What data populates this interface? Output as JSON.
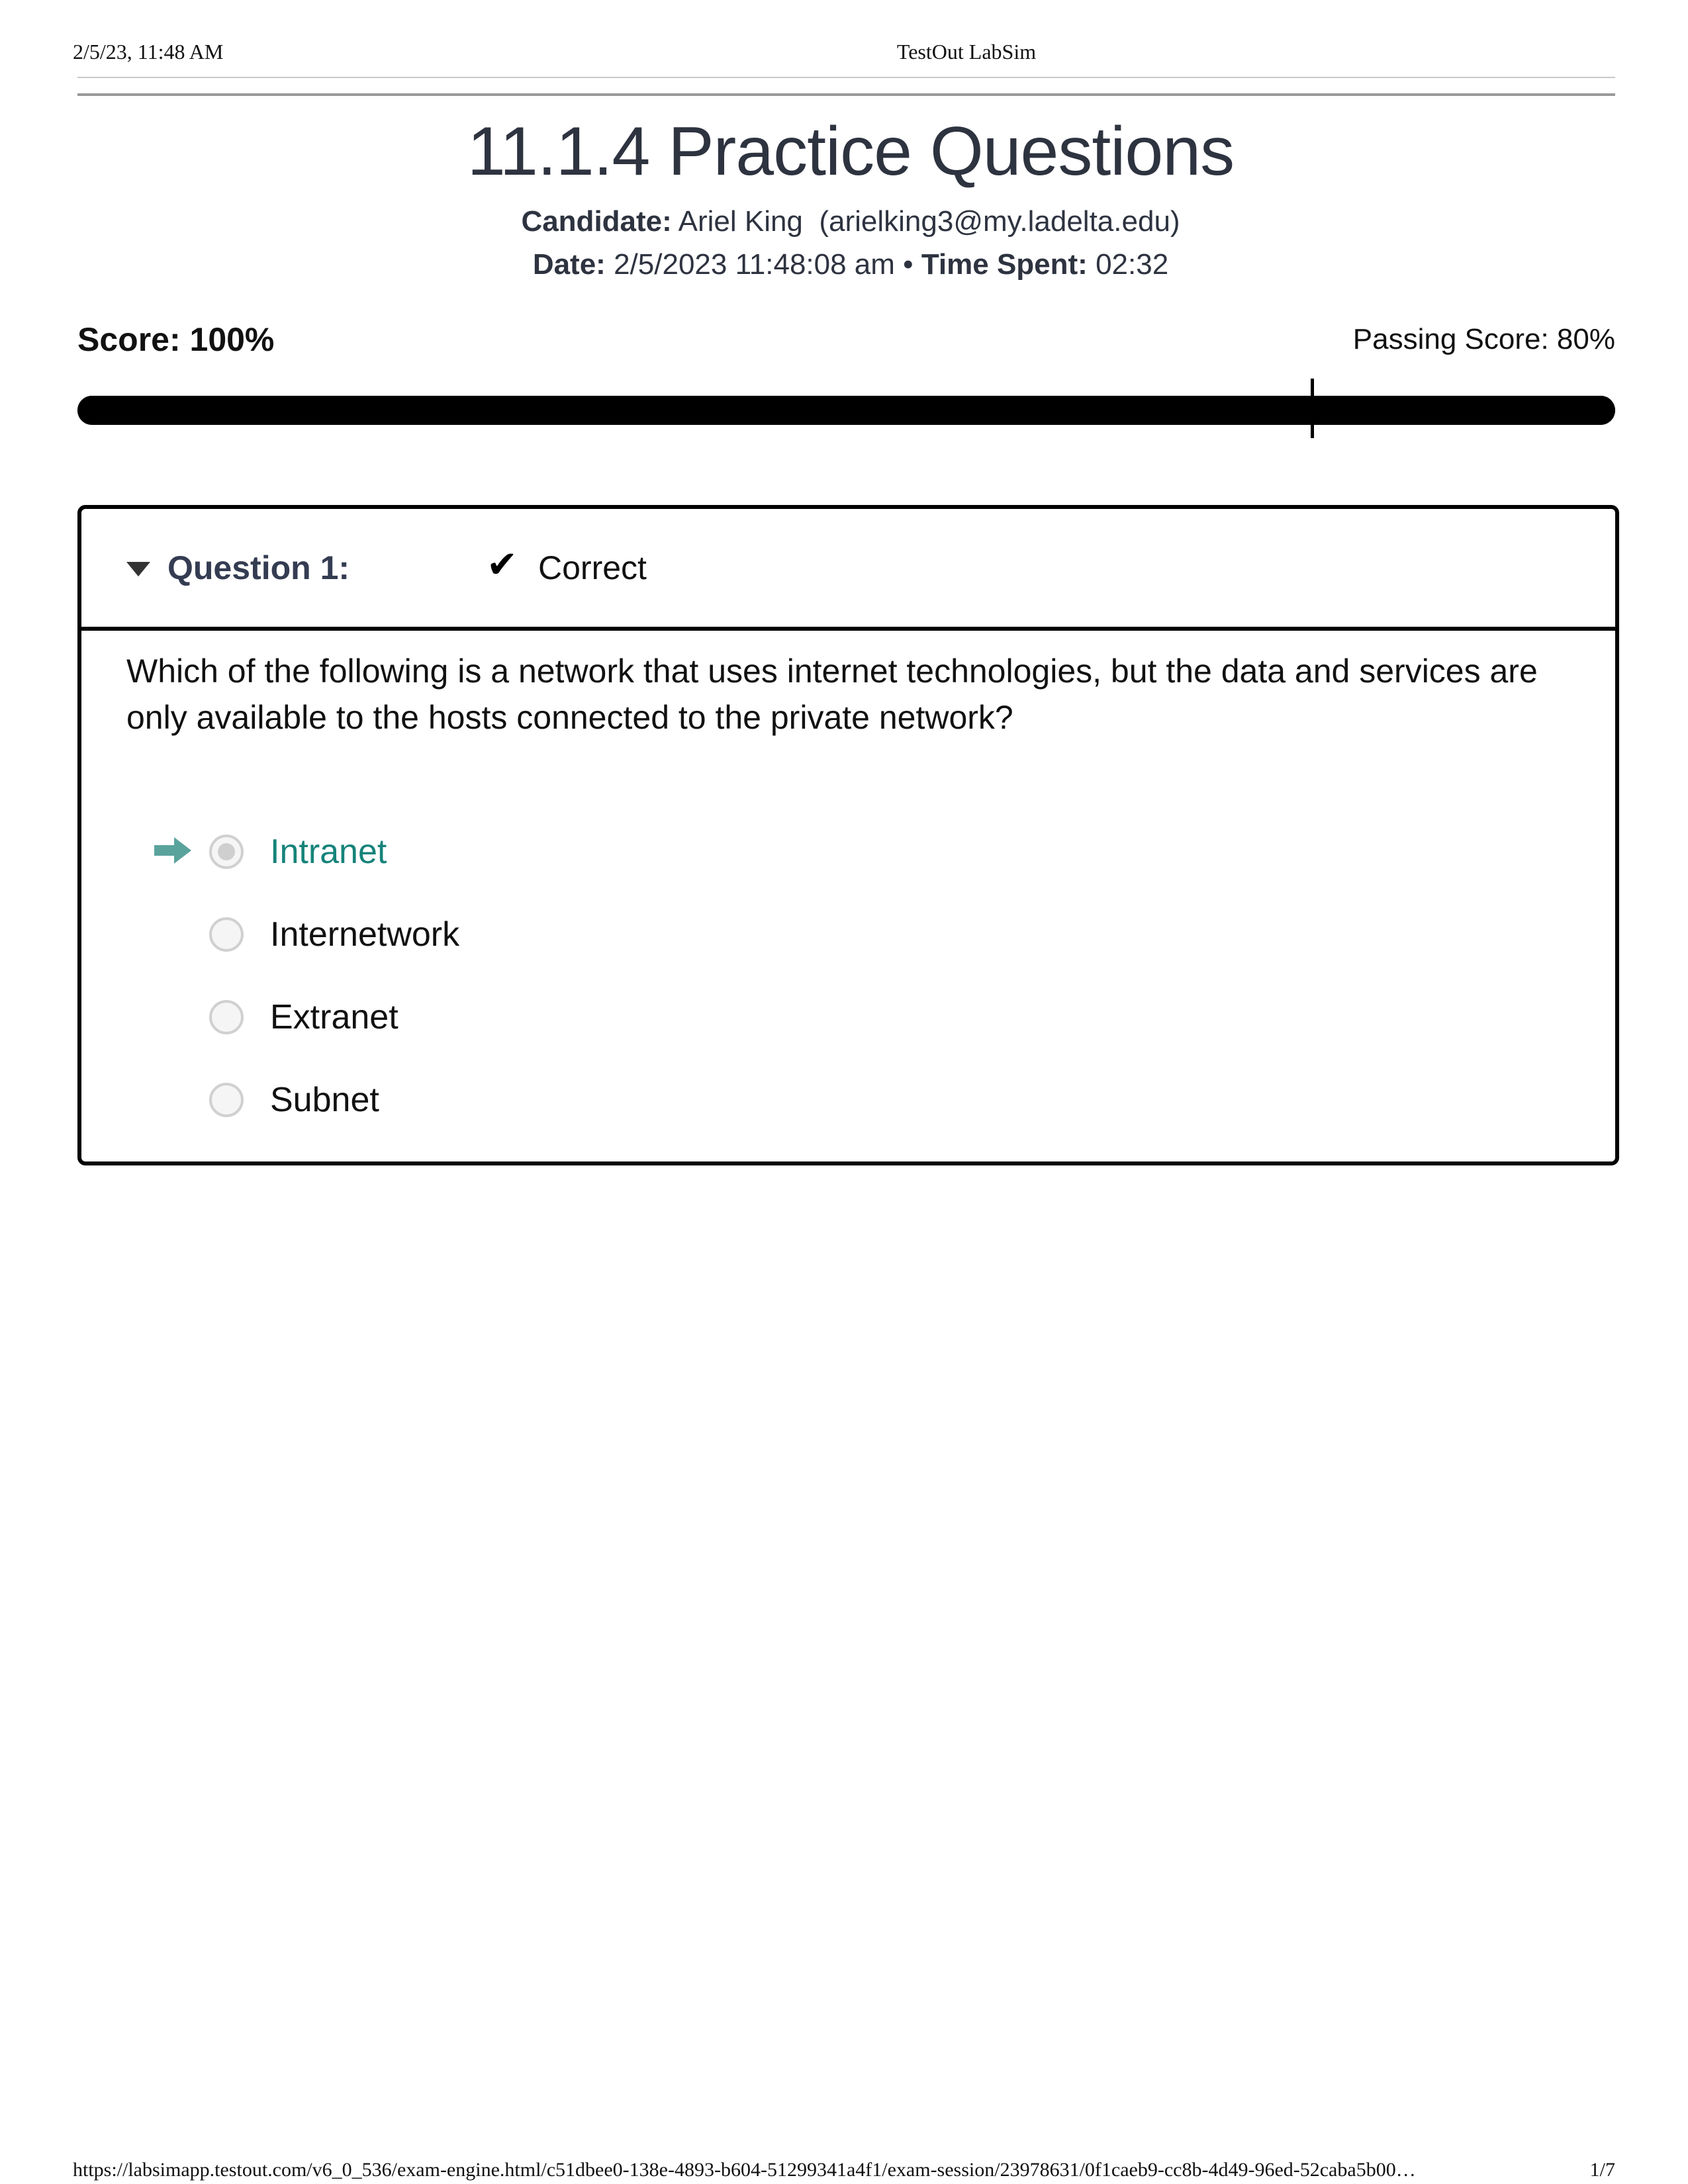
{
  "print_header": {
    "datetime": "2/5/23, 11:48 AM",
    "title": "TestOut LabSim"
  },
  "page": {
    "title": "11.1.4 Practice Questions",
    "candidate_label": "Candidate:",
    "candidate_value": "Ariel King  (arielking3@my.ladelta.edu)",
    "date_label": "Date:",
    "date_value": "2/5/2023 11:48:08 am",
    "separator": "•",
    "time_label": "Time Spent:",
    "time_value": "02:32"
  },
  "score": {
    "label": "Score: 100%",
    "value_percent": 100,
    "passing_label": "Passing Score: 80%",
    "passing_percent": 80,
    "bar_color": "#000000"
  },
  "question": {
    "label": "Question 1:",
    "status_icon": "checkmark-icon",
    "status_glyph": "✔",
    "status": "Correct",
    "text": "Which of the following is a network that uses internet technologies, but the data and services are only available to the hosts connected to the private network?",
    "selected_color": "#16837a",
    "arrow_color": "#5aa39c",
    "options": [
      {
        "label": "Intranet",
        "selected": true,
        "correct": true
      },
      {
        "label": "Internetwork",
        "selected": false,
        "correct": false
      },
      {
        "label": "Extranet",
        "selected": false,
        "correct": false
      },
      {
        "label": "Subnet",
        "selected": false,
        "correct": false
      }
    ]
  },
  "print_footer": {
    "url": "https://labsimapp.testout.com/v6_0_536/exam-engine.html/c51dbee0-138e-4893-b604-51299341a4f1/exam-session/23978631/0f1caeb9-cc8b-4d49-96ed-52caba5b00…",
    "page": "1/7"
  }
}
